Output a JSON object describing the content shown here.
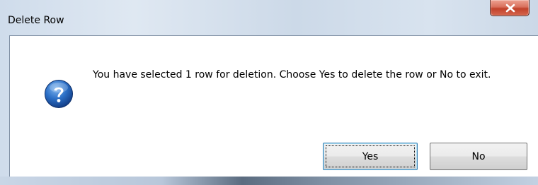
{
  "window": {
    "title": "Delete Row"
  },
  "dialog": {
    "icon": "question-icon",
    "message": "You have selected 1 row for deletion. Choose Yes to delete the row or No to exit.",
    "buttons": {
      "yes_label": "Yes",
      "no_label": "No"
    }
  },
  "colors": {
    "close_button": "#c0412a",
    "icon_blue": "#1f5fb4",
    "focus_border": "#3c7fb1"
  }
}
